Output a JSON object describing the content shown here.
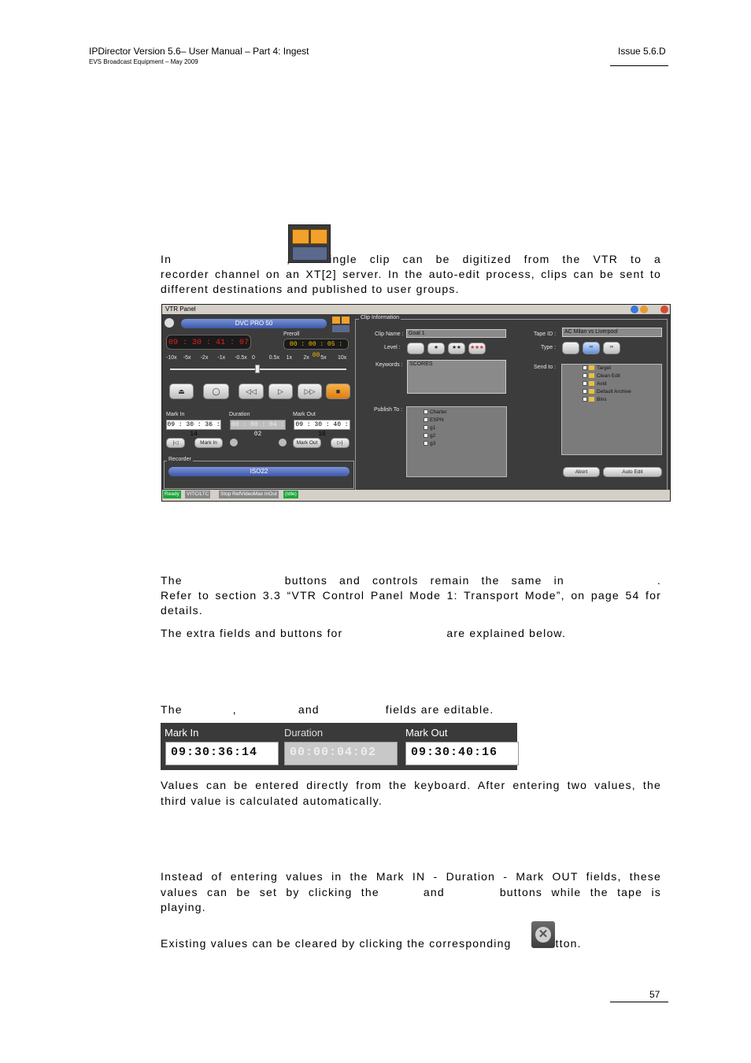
{
  "header": {
    "title": "IPDirector Version 5.6– User Manual – Part 4: Ingest",
    "subtitle": "EVS Broadcast Equipment – May 2009",
    "issue": "Issue 5.6.D"
  },
  "footer": {
    "page": "57"
  },
  "intro": {
    "first": "In",
    "after_icon": ", a single clip can be digitized from the VTR to a",
    "line2": "recorder channel on an XT[2] server. In the auto-edit process, clips can be sent to",
    "line3": "different destinations and published to user groups."
  },
  "vtr_panel": {
    "title": "VTR Panel",
    "format": "DVC PRO 50",
    "timecode": "09 : 30 : 41 : 07",
    "preroll_label": "Preroll",
    "preroll": "00 : 00 : 05 : 00",
    "speeds": [
      "-10x",
      "-5x",
      "-2x",
      "-1x",
      "-0.5x",
      "0",
      "0.5x",
      "1x",
      "2x",
      "5x",
      "10x"
    ],
    "mark_in_label": "Mark In",
    "duration_label": "Duration",
    "mark_out_label": "Mark Out",
    "mark_in": "09 : 30 : 36 : 14",
    "duration": "00 : 00 : 04 : 02",
    "mark_out": "09 : 30 : 40 : 16",
    "mark_in_btn": "Mark In",
    "mark_out_btn": "Mark Out",
    "recorder_label": "Recorder",
    "recorder": "ISO22",
    "clip_info_label": "Clip Information",
    "clip_name_label": "Clip Name :",
    "clip_name": "Goal 1",
    "level_label": "Level :",
    "keywords_label": "Keywords :",
    "keywords": "SCORES",
    "publish_label": "Publish To :",
    "publish_items": [
      "Charter",
      "ESPN",
      "g1",
      "g2",
      "g3"
    ],
    "tape_id_label": "Tape ID :",
    "tape_id": "AC Milan vs Liverpool",
    "type_label": "Type :",
    "send_to_label": "Send to :",
    "send_items": [
      "Target",
      "Clean Edit",
      "Avid",
      "Default Archive",
      "Bins"
    ],
    "abort": "Abort",
    "auto_edit": "Auto Edit",
    "status": [
      "Ready",
      "VITC/LTC",
      "Stop RefVideoMax InOut",
      "(Idle)"
    ]
  },
  "para1": {
    "the": "The",
    "middle": "buttons and controls remain the same in",
    "end": ".",
    "line2": "Refer to section 3.3 “VTR Control Panel Mode 1: Transport Mode”, on page 54 for",
    "line3": "details."
  },
  "para2": {
    "start": "The extra fields and buttons for",
    "end": "are explained below."
  },
  "para3": {
    "the": "The",
    "comma": ",",
    "and": "and",
    "end": "fields are editable."
  },
  "mark_fig": {
    "mark_in_label": "Mark In",
    "duration_label": "Duration",
    "mark_out_label": "Mark Out",
    "mark_in": "09:30:36:14",
    "duration": "00:00:04:02",
    "mark_out": "09:30:40:16"
  },
  "para4": {
    "line1": "Values can be entered directly from the keyboard.  After entering two values, the",
    "line2": "third value is calculated automatically."
  },
  "para5": {
    "line1": "Instead of entering values in the Mark IN - Duration - Mark OUT fields, these",
    "line2a": "values can be set by clicking the",
    "line2b": "and",
    "line2c": "buttons while the tape is",
    "line3": "playing."
  },
  "para6": {
    "start": "Existing values can be cleared by clicking the corresponding",
    "end": "button."
  }
}
